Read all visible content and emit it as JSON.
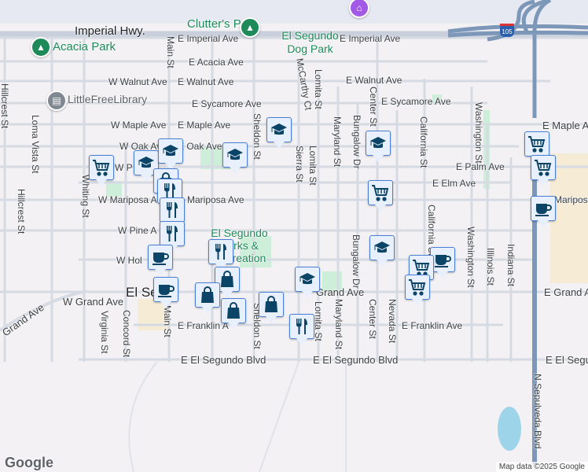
{
  "map": {
    "streets": {
      "imperial_hwy": "Imperial Hwy.",
      "e_imperial_1": "E Imperial Ave",
      "e_imperial_2": "E Imperial Ave",
      "e_acacia": "E Acacia Ave",
      "w_walnut": "W Walnut Ave",
      "e_walnut_1": "E Walnut Ave",
      "e_walnut_2": "E Walnut Ave",
      "e_sycamore_1": "E Sycamore Ave",
      "e_sycamore_2": "E Sycamore Ave",
      "w_maple": "W Maple Ave",
      "e_maple_1": "E Maple Ave",
      "e_maple_2": "E Maple Ave",
      "w_oak": "W Oak Ave",
      "e_oak": "E Oak Ave",
      "w_palm": "W P",
      "e_palm": "E Palm Ave",
      "e_elm": "E Elm Ave",
      "w_mariposa": "W Mariposa Ave",
      "e_mariposa_1": "Mariposa Ave",
      "e_mariposa_2": "Mariposa Ave",
      "w_pine": "W Pine A",
      "w_holly": "W Hol",
      "w_grand": "W Grand Ave",
      "grand_sw": "Grand Ave",
      "e_grand_1": "Grand Ave",
      "e_grand_2": "E Grand Ave",
      "e_franklin_1": "E Franklin A",
      "e_franklin_2": "E Franklin Ave",
      "e_el_segundo_1": "E El Segundo Blvd",
      "e_el_segundo_2": "E El Segundo Blvd",
      "e_el_segundo_3": "E El Segu",
      "main_st_1": "Main St",
      "main_st_2": "Main St",
      "hillcrest_1": "Hillcrest St",
      "hillcrest_2": "Hillcrest St",
      "loma_vista": "Loma Vista St",
      "whiting": "Whiting St",
      "virginia": "Virginia St",
      "concord": "Concord St",
      "sheldon_1": "Sheldon St",
      "sheldon_2": "Sheldon St",
      "mccarthy": "McCarthy Ct",
      "lomita_1": "Lomita St",
      "lomita_2": "Lomita St",
      "lomita_3": "Lomita St",
      "sierra": "Sierra St",
      "maryland_1": "Maryland St",
      "maryland_2": "Maryland St",
      "bungalow_1": "Bungalow Dr",
      "bungalow_2": "Bungalow Dr",
      "center_1": "Center St",
      "center_2": "Center St",
      "california_1": "California St",
      "california_2": "California St",
      "washington_1": "Washington St",
      "washington_2": "Washington St",
      "nevada": "Nevada St",
      "illinois": "Illinois St",
      "indiana": "Indiana St",
      "sepulveda": "N Sepulveda Blvd",
      "st_frag": "St"
    },
    "places": {
      "clutters_park": "Clutter's Park",
      "acacia_park": "Acacia Park",
      "dog_park": "El Segundo Dog Park",
      "library": "LittleFreeLibrary",
      "parks_rec": "El Segundo Parks & Recreation",
      "city": "El Se"
    },
    "highway_shield": "105",
    "markers": [
      "school",
      "school",
      "school",
      "cart",
      "school",
      "school",
      "bag",
      "cart",
      "cart",
      "cart",
      "coffee",
      "restaurant",
      "restaurant",
      "restaurant",
      "school",
      "coffee",
      "coffee",
      "restaurant",
      "bag",
      "bag",
      "bag",
      "bag",
      "school",
      "restaurant",
      "coffee",
      "cart",
      "cart"
    ],
    "colors": {
      "marker_icon": "#0b4466",
      "park": "#1e8a5a",
      "highway": "#7d97b9"
    },
    "attribution": "Map data ©2025 Google",
    "logo": "Google"
  }
}
